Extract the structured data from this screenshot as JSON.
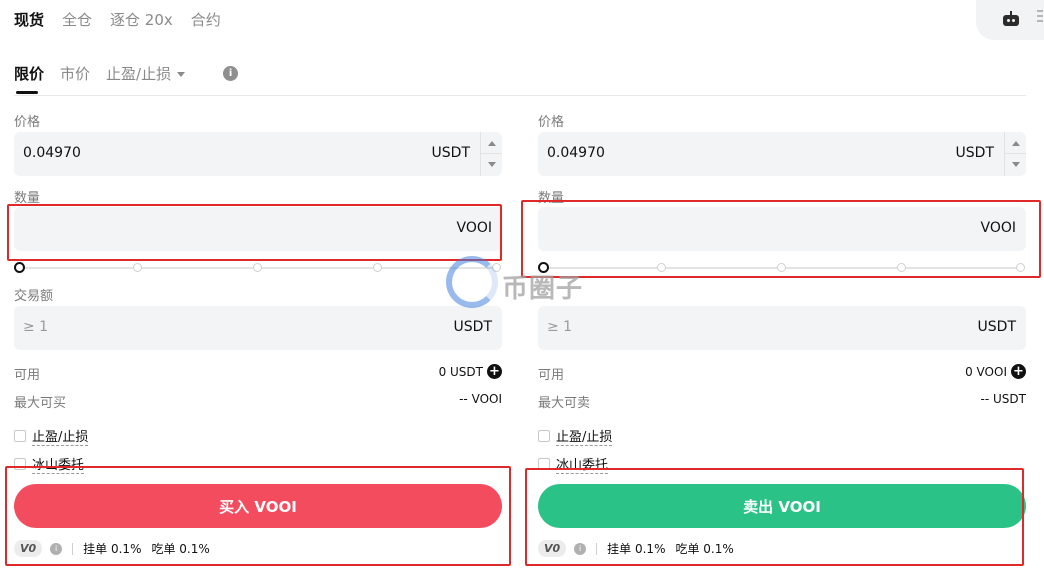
{
  "top_tabs": [
    "现货",
    "全仓",
    "逐仓 20x",
    "合约"
  ],
  "order_tabs": {
    "limit": "限价",
    "market": "市价",
    "tpsl": "止盈/止损"
  },
  "buy": {
    "price_label": "价格",
    "price_value": "0.04970",
    "price_unit": "USDT",
    "qty_label": "数量",
    "qty_unit": "VOOI",
    "amount_label": "交易额",
    "amount_placeholder": "≥ 1",
    "amount_unit": "USDT",
    "avail_label": "可用",
    "avail_value": "0 USDT",
    "max_label": "最大可买",
    "max_value": "-- VOOI",
    "tpsl_label": "止盈/止损",
    "iceberg_label": "冰山委托",
    "button_label": "买入 VOOI",
    "vip_badge": "V0",
    "maker_fee": "挂单 0.1%",
    "taker_fee": "吃单 0.1%"
  },
  "sell": {
    "price_label": "价格",
    "price_value": "0.04970",
    "price_unit": "USDT",
    "qty_label": "数量",
    "qty_unit": "VOOI",
    "amount_placeholder": "≥ 1",
    "amount_unit": "USDT",
    "avail_label": "可用",
    "avail_value": "0 VOOI",
    "max_label": "最大可卖",
    "max_value": "-- USDT",
    "tpsl_label": "止盈/止损",
    "iceberg_label": "冰山委托",
    "button_label": "卖出 VOOI",
    "vip_badge": "V0",
    "maker_fee": "挂单 0.1%",
    "taker_fee": "吃单 0.1%"
  },
  "watermark": "币圈子",
  "colors": {
    "buy": "#f34c5f",
    "sell": "#2bc287",
    "highlight": "#e02a2a"
  }
}
